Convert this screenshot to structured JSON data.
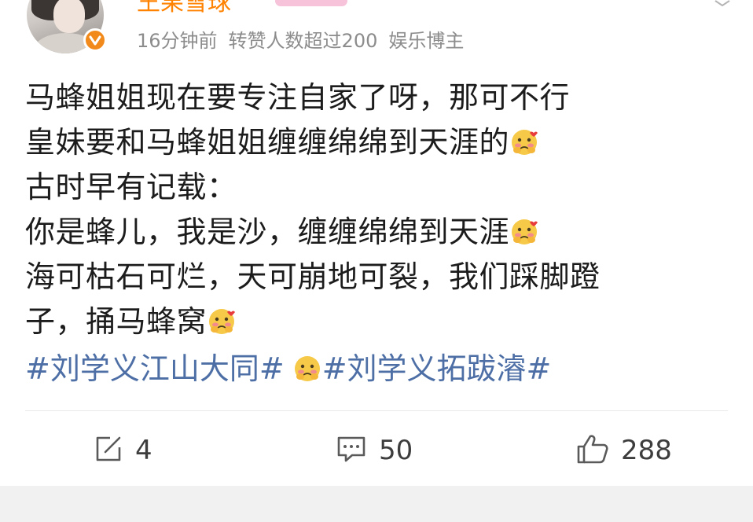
{
  "header": {
    "username": "王果雪球",
    "time": "16分钟前",
    "repost_note": "转赞人数超过200",
    "category": "娱乐博主"
  },
  "post": {
    "lines": [
      "马蜂姐姐现在要专注自家了呀，那可不行",
      "皇妹要和马蜂姐姐缠缠绵绵到天涯的",
      "古时早有记载：",
      "你是蜂儿，我是沙，缠缠绵绵到天涯",
      "海可枯石可烂，天可崩地可裂，我们踩脚蹬",
      "子，捅马蜂窝"
    ],
    "hashtags": [
      "#刘学义江山大同#",
      "#刘学义拓跋濬#"
    ],
    "emoji": "blush-emoji"
  },
  "actions": {
    "repost_count": "4",
    "comment_count": "50",
    "like_count": "288"
  },
  "colors": {
    "username": "#ff8200",
    "hashtag": "#4d6fa6",
    "verified": "#f28a1b",
    "meta": "#8c8c8c"
  }
}
